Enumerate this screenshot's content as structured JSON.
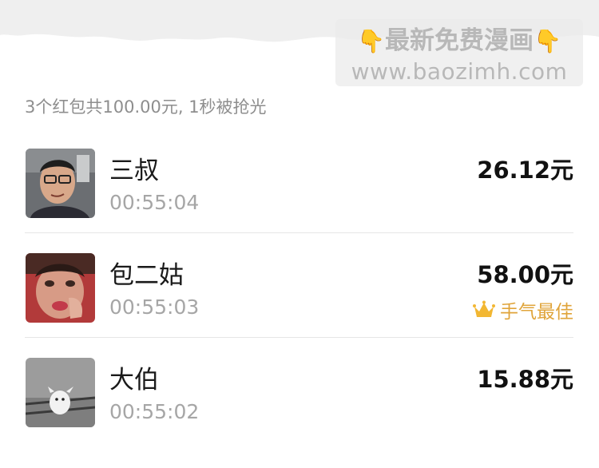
{
  "watermark": {
    "line1": "最新免费漫画",
    "hand_icon": "👇",
    "line2": "www.baozimh.com"
  },
  "summary": "3个红包共100.00元, 1秒被抢光",
  "entries": [
    {
      "name": "三叔",
      "time": "00:55:04",
      "amount": "26.12元",
      "badge": ""
    },
    {
      "name": "包二姑",
      "time": "00:55:03",
      "amount": "58.00元",
      "badge": "手气最佳"
    },
    {
      "name": "大伯",
      "time": "00:55:02",
      "amount": "15.88元",
      "badge": ""
    }
  ],
  "colors": {
    "badge": "#e0a43a",
    "summary_text": "#8e8e8e",
    "time_text": "#a6a6a6"
  },
  "icons": [
    "hand-pointing-down-icon",
    "crown-icon"
  ]
}
